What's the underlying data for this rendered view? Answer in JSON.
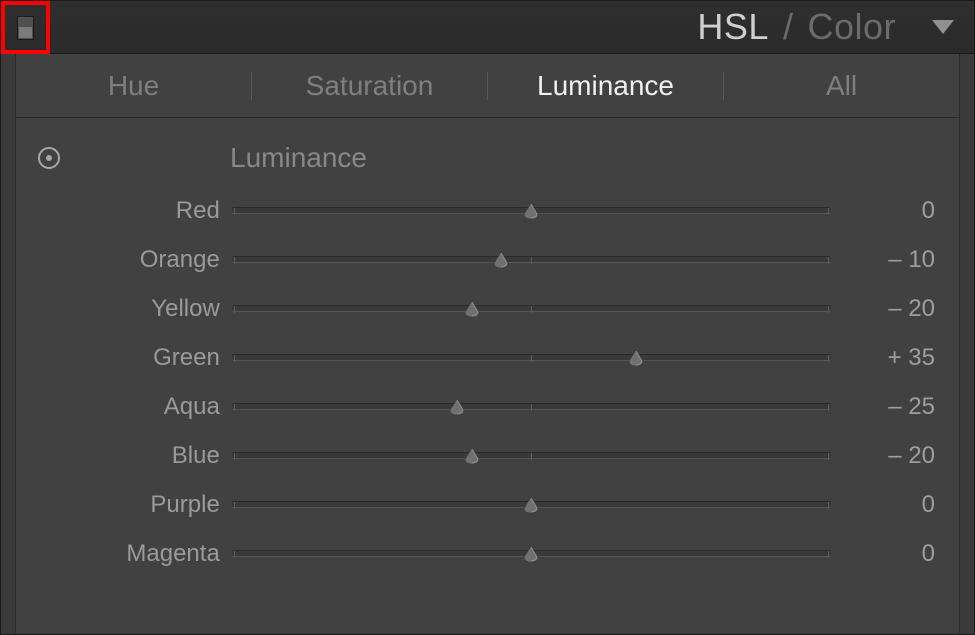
{
  "header": {
    "mode_hsl": "HSL",
    "mode_sep": "/",
    "mode_color": "Color"
  },
  "tabs": {
    "hue": "Hue",
    "saturation": "Saturation",
    "luminance": "Luminance",
    "all": "All",
    "active": "luminance"
  },
  "section": {
    "title": "Luminance"
  },
  "sliders": {
    "range_min": -100,
    "range_max": 100,
    "items": [
      {
        "label": "Red",
        "value": 0,
        "display": "0"
      },
      {
        "label": "Orange",
        "value": -10,
        "display": "– 10"
      },
      {
        "label": "Yellow",
        "value": -20,
        "display": "– 20"
      },
      {
        "label": "Green",
        "value": 35,
        "display": "+ 35"
      },
      {
        "label": "Aqua",
        "value": -25,
        "display": "– 25"
      },
      {
        "label": "Blue",
        "value": -20,
        "display": "– 20"
      },
      {
        "label": "Purple",
        "value": 0,
        "display": "0"
      },
      {
        "label": "Magenta",
        "value": 0,
        "display": "0"
      }
    ]
  }
}
